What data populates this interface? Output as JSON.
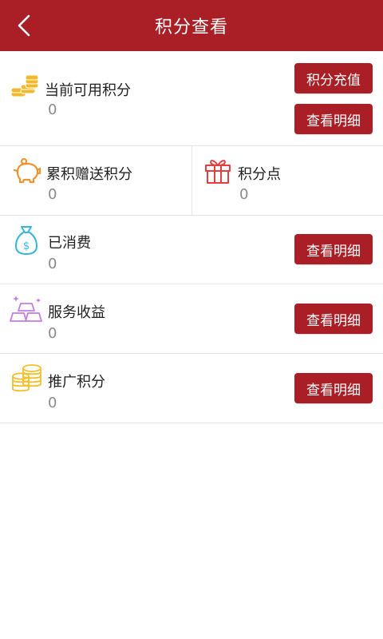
{
  "header": {
    "title": "积分查看",
    "back_icon": "chevron-left-icon",
    "bg_color": "#a91f25"
  },
  "current_points": {
    "label": "当前可用积分",
    "value": "0",
    "icon": "coins-stack-icon",
    "recharge_button": "积分充值",
    "detail_button": "查看明细"
  },
  "gift_points": {
    "label": "累积赠送积分",
    "value": "0",
    "icon": "piggy-bank-icon"
  },
  "points_spot": {
    "label": "积分点",
    "value": "0",
    "icon": "gift-box-icon"
  },
  "consumed": {
    "label": "已消费",
    "value": "0",
    "icon": "money-bag-icon",
    "detail_button": "查看明细"
  },
  "service_income": {
    "label": "服务收益",
    "value": "0",
    "icon": "gold-bars-icon",
    "detail_button": "查看明细"
  },
  "promotion_points": {
    "label": "推广积分",
    "value": "0",
    "icon": "coin-stacks-icon",
    "detail_button": "查看明细"
  }
}
